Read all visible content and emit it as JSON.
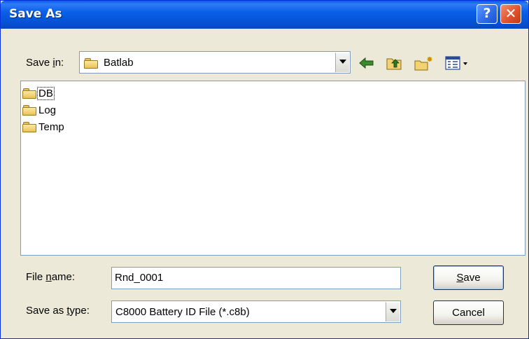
{
  "window": {
    "title": "Save As",
    "help_label": "?",
    "close_label": "✕"
  },
  "save_in": {
    "label_prefix": "Save ",
    "label_accel": "i",
    "label_suffix": "n:",
    "folder": "Batlab"
  },
  "toolbar": {
    "back_icon": "back-arrow-icon",
    "up_icon": "up-folder-icon",
    "new_folder_icon": "new-folder-icon",
    "views_icon": "views-menu-icon"
  },
  "files": [
    {
      "name": "DB",
      "icon": "folder-icon",
      "focused": true
    },
    {
      "name": "Log",
      "icon": "folder-icon",
      "focused": false
    },
    {
      "name": "Temp",
      "icon": "folder-icon",
      "focused": false
    }
  ],
  "file_name": {
    "label_prefix": "File ",
    "label_accel": "n",
    "label_suffix": "ame:",
    "value": "Rnd_0001"
  },
  "save_type": {
    "label_prefix": "Save as ",
    "label_accel": "t",
    "label_suffix": "ype:",
    "value": "C8000 Battery ID File (*.c8b)"
  },
  "buttons": {
    "save_accel": "S",
    "save_rest": "ave",
    "cancel": "Cancel"
  },
  "colors": {
    "titlebar": "#0553d6",
    "dialog_bg": "#ece9d8",
    "close": "#e0542f"
  }
}
